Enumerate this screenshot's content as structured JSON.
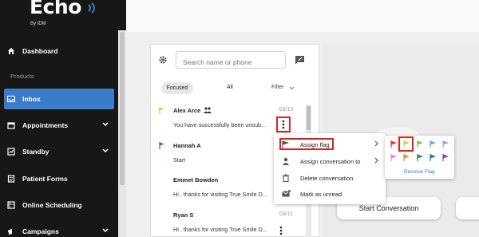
{
  "brand": {
    "name": "Echo",
    "sub": "By IDM"
  },
  "sidebar": {
    "section_label": "Products",
    "items": [
      {
        "label": "Dashboard",
        "icon": "home-icon"
      },
      {
        "label": "Inbox",
        "icon": "inbox-icon",
        "active": true
      },
      {
        "label": "Appointments",
        "icon": "calendar-icon"
      },
      {
        "label": "Standby",
        "icon": "standby-icon"
      },
      {
        "label": "Patient Forms",
        "icon": "forms-icon"
      },
      {
        "label": "Online Scheduling",
        "icon": "scheduling-icon"
      },
      {
        "label": "Campaigns",
        "icon": "campaigns-icon"
      }
    ]
  },
  "inbox": {
    "search_placeholder": "Search name or phone",
    "tabs": {
      "focused": "Focused",
      "all": "All",
      "filter": "Filter"
    },
    "conversations": [
      {
        "name": "Alex Arce",
        "date": "03/13",
        "preview": "You have successfully been unsub...",
        "flag": "yellow",
        "group": true
      },
      {
        "name": "Hannah A",
        "date": "",
        "preview": "Start",
        "flag": "green"
      },
      {
        "name": "Emmet Bowden",
        "date": "",
        "preview": "Hi , thanks for visiting True Smile D..."
      },
      {
        "name": "Ryan S",
        "date": "03/11",
        "preview": "Hi , thanks for visiting True Smile D..."
      }
    ]
  },
  "context_menu": {
    "items": [
      {
        "label": "Assign flag",
        "icon": "flag-icon",
        "submenu": true
      },
      {
        "label": "Assign conversation to",
        "icon": "person-icon",
        "submenu": true
      },
      {
        "label": "Delete conversation",
        "icon": "trash-icon"
      },
      {
        "label": "Mark as unread",
        "icon": "mail-icon"
      }
    ]
  },
  "flag_menu": {
    "colors_row1": [
      "#e53935",
      "#f4c542",
      "#7cc36b",
      "#6fa8dc",
      "#b39ddb"
    ],
    "colors_row2": [
      "#f48fb1",
      "#ef8a3c",
      "#2e8b57",
      "#1976d2",
      "#8e44ad"
    ],
    "remove_label": "Remove Flag"
  },
  "main": {
    "start_button": "Start Conversation"
  }
}
